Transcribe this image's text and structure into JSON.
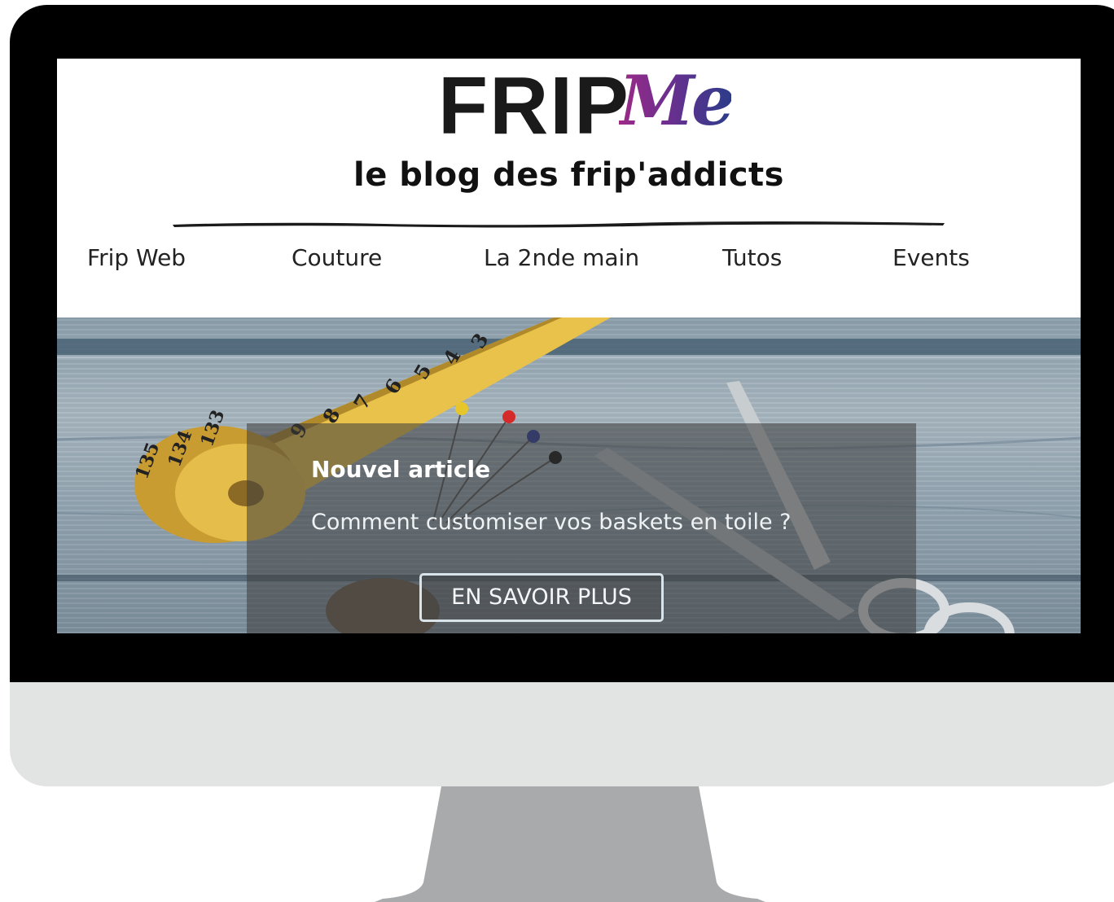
{
  "brand": {
    "logo_main": "FRIP",
    "logo_script": "Me",
    "tagline": "le blog des frip'addicts"
  },
  "nav": {
    "items": [
      {
        "label": "Frip Web"
      },
      {
        "label": "Couture"
      },
      {
        "label": "La 2nde main"
      },
      {
        "label": "Tutos"
      },
      {
        "label": "Events"
      }
    ]
  },
  "hero": {
    "kicker": "Nouvel article",
    "title": "Comment customiser vos baskets en toile ?",
    "button_label": "EN SAVOIR PLUS",
    "tape_numbers": [
      "135",
      "134",
      "133",
      "9",
      "8",
      "7",
      "6",
      "5",
      "4",
      "3"
    ]
  },
  "colors": {
    "logo_gradient_start": "#9c2a86",
    "logo_gradient_end": "#2b3c8a",
    "bezel": "#000000",
    "chin": "#e2e3e3",
    "stand": "#a9aaab"
  }
}
